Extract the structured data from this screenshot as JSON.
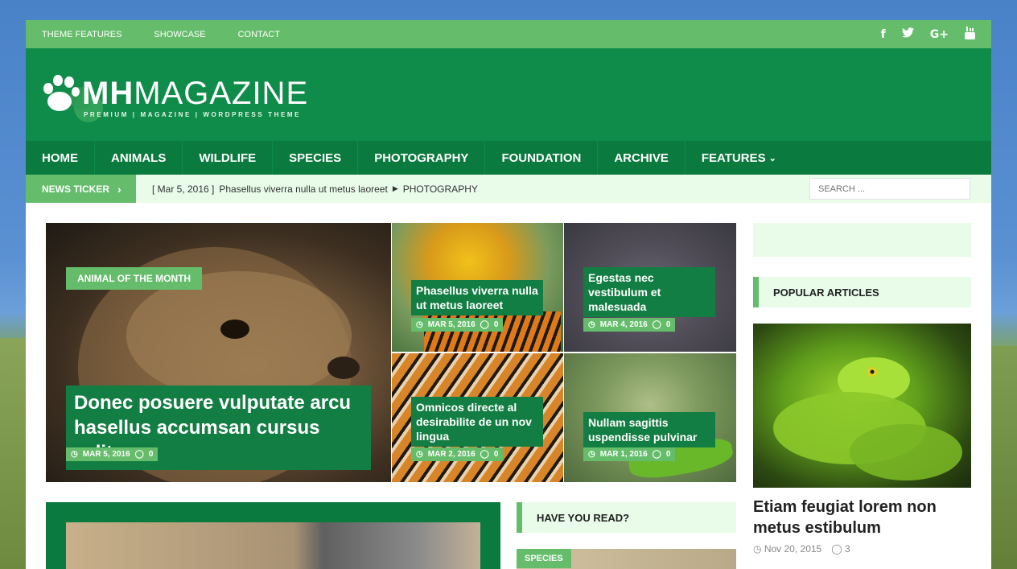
{
  "top_nav": [
    "THEME FEATURES",
    "SHOWCASE",
    "CONTACT"
  ],
  "social_icons": [
    "facebook-icon",
    "twitter-icon",
    "google-plus-icon",
    "youtube-icon"
  ],
  "logo": {
    "bold": "MH",
    "light": "MAGAZINE",
    "tagline": "PREMIUM | MAGAZINE | WORDPRESS THEME"
  },
  "main_nav": [
    "HOME",
    "ANIMALS",
    "WILDLIFE",
    "SPECIES",
    "PHOTOGRAPHY",
    "FOUNDATION",
    "ARCHIVE",
    "FEATURES"
  ],
  "ticker": {
    "label": "NEWS TICKER",
    "date": "[ Mar 5, 2016 ]",
    "headline": "Phasellus viverra nulla ut metus laoreet",
    "category": "PHOTOGRAPHY"
  },
  "search": {
    "placeholder": "SEARCH ..."
  },
  "featured": [
    {
      "title": "Donec posuere vulputate arcu hasellus accumsan cursus velit",
      "date": "MAR 5, 2016",
      "comments": "0"
    },
    {
      "title": "Phasellus viverra nulla ut metus laoreet",
      "date": "MAR 5, 2016",
      "comments": "0"
    },
    {
      "title": "Egestas nec vestibulum et malesuada",
      "date": "MAR 4, 2016",
      "comments": "0"
    },
    {
      "title": "Omnicos directe al desirabilite de un nov lingua",
      "date": "MAR 2, 2016",
      "comments": "0"
    },
    {
      "title": "Nullam sagittis uspendisse pulvinar",
      "date": "MAR 1, 2016",
      "comments": "0"
    }
  ],
  "sidebar": {
    "popular_heading": "POPULAR ARTICLES",
    "popular_title": "Etiam feugiat lorem non metus estibulum",
    "popular_date": "Nov 20, 2015",
    "popular_comments": "3"
  },
  "have_you_read": "HAVE YOU READ?",
  "animal_of_month": "ANIMAL OF THE MONTH",
  "species_label": "SPECIES",
  "colors": {
    "primary": "#0f8c49",
    "accent": "#65bd6b",
    "nav": "#0b7a3e",
    "light": "#e8fce9"
  }
}
